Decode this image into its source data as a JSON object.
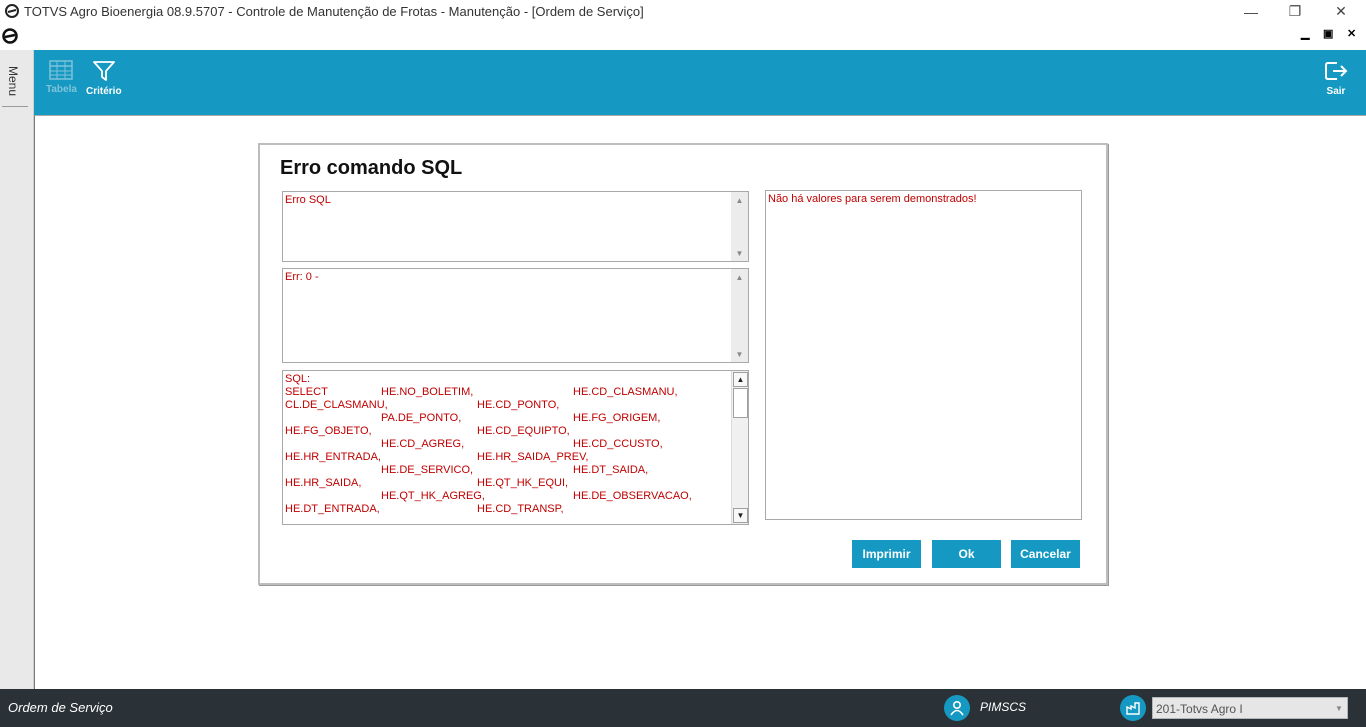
{
  "window": {
    "title": "TOTVS Agro Bioenergia 08.9.5707 - Controle de Manutenção de Frotas - Manutenção - [Ordem de Serviço]",
    "controls": {
      "minimize": "—",
      "restore": "❐",
      "close": "✕"
    }
  },
  "mdi": {
    "minimize": "▁",
    "restore": "▣",
    "close": "✕"
  },
  "leftmenu": {
    "label": "Menu"
  },
  "toolbar": {
    "tabela_label": "Tabela",
    "criterio_label": "Critério",
    "sair_label": "Sair"
  },
  "dialog": {
    "title": "Erro comando SQL",
    "memo1": "Erro SQL",
    "memo2": "Err: 0 -",
    "memo3": {
      "header": "SQL:",
      "rows": [
        [
          "SELECT",
          "HE.NO_BOLETIM,",
          "",
          "HE.CD_CLASMANU,"
        ],
        [
          "CL.DE_CLASMANU,",
          "",
          "HE.CD_PONTO,",
          ""
        ],
        [
          "",
          "PA.DE_PONTO,",
          "",
          "HE.FG_ORIGEM,"
        ],
        [
          "HE.FG_OBJETO,",
          "",
          "HE.CD_EQUIPTO,",
          ""
        ],
        [
          "",
          "HE.CD_AGREG,",
          "",
          "HE.CD_CCUSTO,"
        ],
        [
          "HE.HR_ENTRADA,",
          "",
          "HE.HR_SAIDA_PREV,",
          ""
        ],
        [
          "",
          "HE.DE_SERVICO,",
          "",
          "HE.DT_SAIDA,"
        ],
        [
          "HE.HR_SAIDA,",
          "",
          "HE.QT_HK_EQUI,",
          ""
        ],
        [
          "",
          "HE.QT_HK_AGREG,",
          "",
          "HE.DE_OBSERVACAO,"
        ],
        [
          "HE.DT_ENTRADA,",
          "",
          "HE.CD_TRANSP,",
          ""
        ]
      ]
    },
    "memo4": "Não há valores para serem demonstrados!",
    "buttons": {
      "imprimir": "Imprimir",
      "ok": "Ok",
      "cancelar": "Cancelar"
    }
  },
  "statusbar": {
    "screen_name": "Ordem de Serviço",
    "user": "PIMSCS",
    "company": "201-Totvs Agro I"
  },
  "colors": {
    "accent": "#1599c2",
    "error_text": "#c00000",
    "statusbar": "#2b3237"
  }
}
